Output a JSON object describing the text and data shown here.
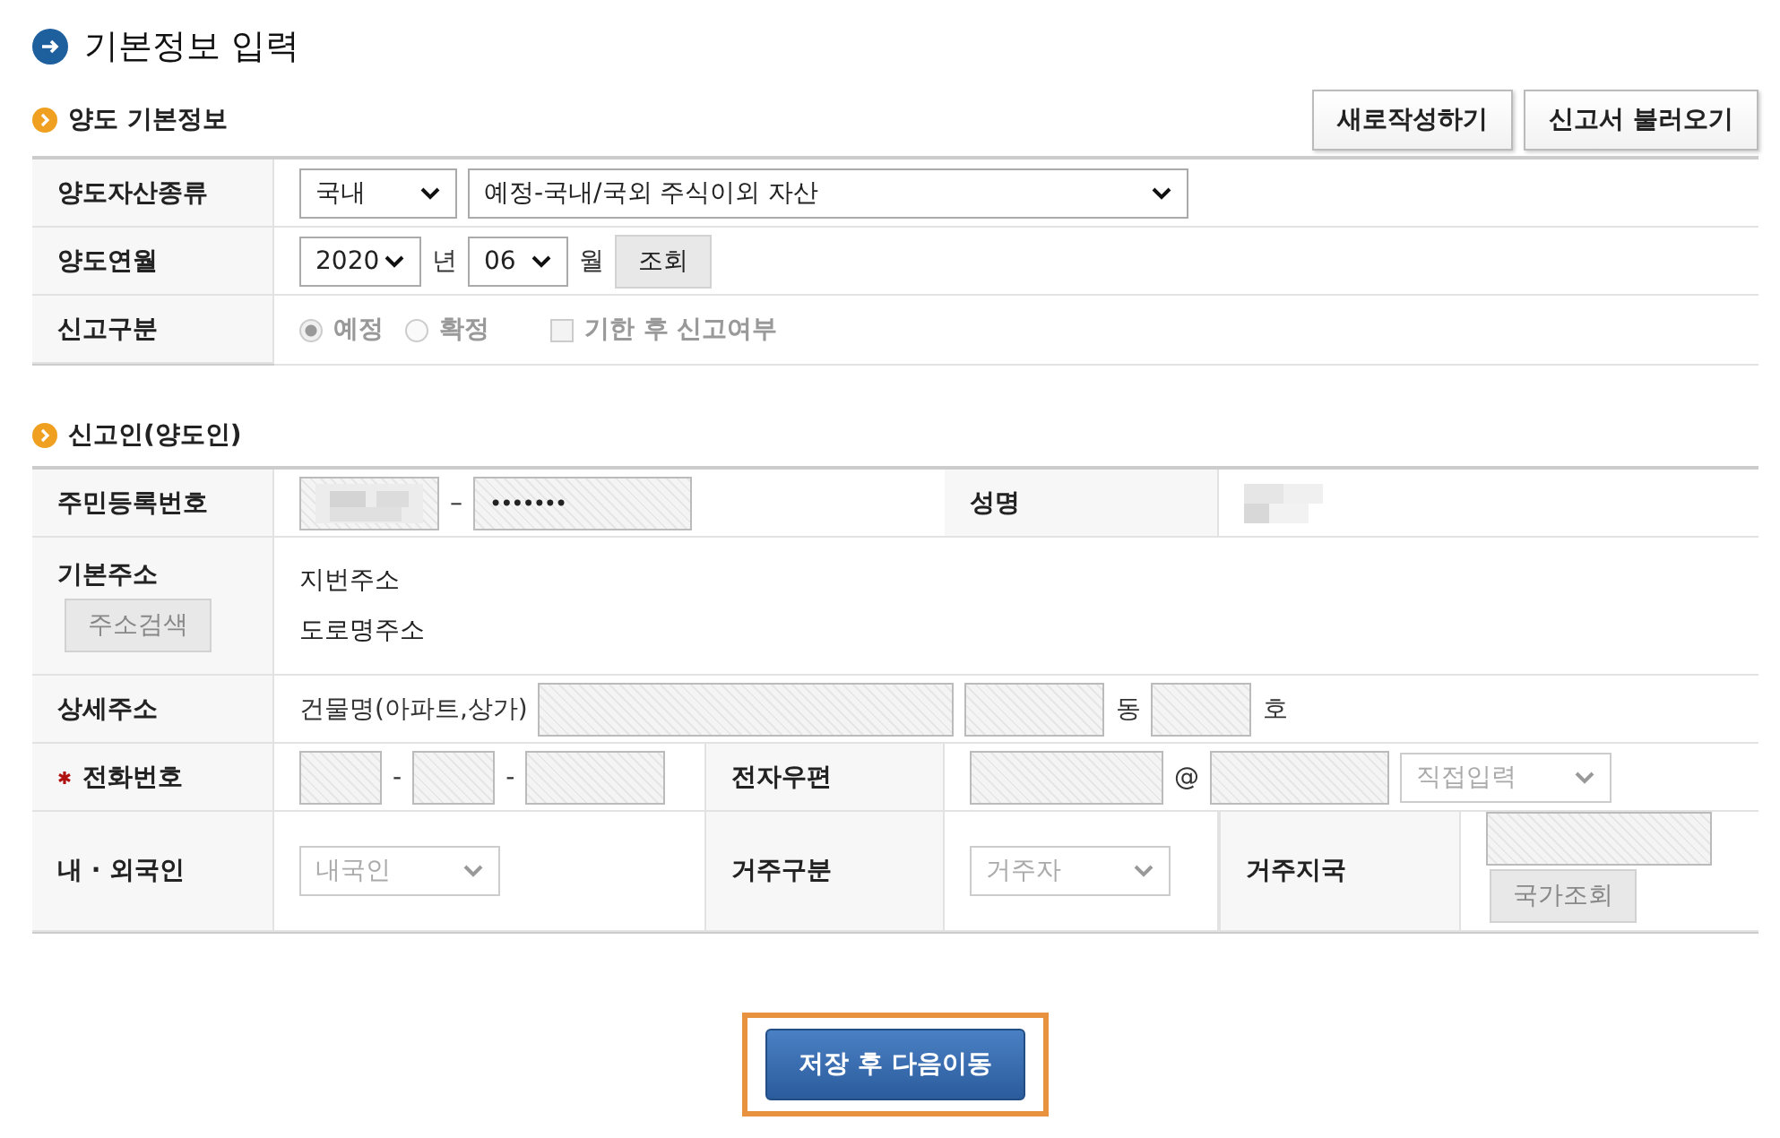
{
  "header": {
    "title": "기본정보 입력"
  },
  "transfer_section": {
    "title": "양도 기본정보",
    "buttons": [
      "새로작성하기",
      "신고서 불러오기"
    ],
    "asset_type": {
      "label": "양도자산종류",
      "domestic_select": "국내",
      "type_select": "예정-국내/국외 주식이외 자산"
    },
    "transfer_month": {
      "label": "양도연월",
      "year": "2020",
      "year_unit": "년",
      "month": "06",
      "month_unit": "월",
      "lookup_button": "조회"
    },
    "report_type": {
      "label": "신고구분",
      "disabled": true,
      "options": [
        {
          "label": "예정",
          "selected": true
        },
        {
          "label": "확정",
          "selected": false
        }
      ],
      "late_filing": {
        "label": "기한 후 신고여부",
        "checked": false
      }
    }
  },
  "reporter_section": {
    "title": "신고인(양도인)",
    "resident_number": {
      "label": "주민등록번호",
      "separator": "–",
      "masked": "•••••••"
    },
    "name": {
      "label": "성명"
    },
    "address": {
      "label": "기본주소",
      "search_button": "주소검색",
      "lot_address": "지번주소",
      "road_address": "도로명주소"
    },
    "detail_address": {
      "label": "상세주소",
      "building_label": "건물명(아파트,상가)",
      "dong_unit": "동",
      "ho_unit": "호"
    },
    "phone": {
      "label": "전화번호",
      "required": true,
      "separators": [
        "-",
        "-"
      ]
    },
    "email": {
      "label": "전자우편",
      "at": "@",
      "domain_select": "직접입력"
    },
    "nationality": {
      "label": "내 · 외국인",
      "select": "내국인"
    },
    "residency": {
      "label": "거주구분",
      "select": "거주자"
    },
    "country": {
      "label": "거주지국",
      "lookup_button": "국가조회"
    }
  },
  "footer": {
    "save_button": "저장 후 다음이동",
    "highlighted": true
  }
}
